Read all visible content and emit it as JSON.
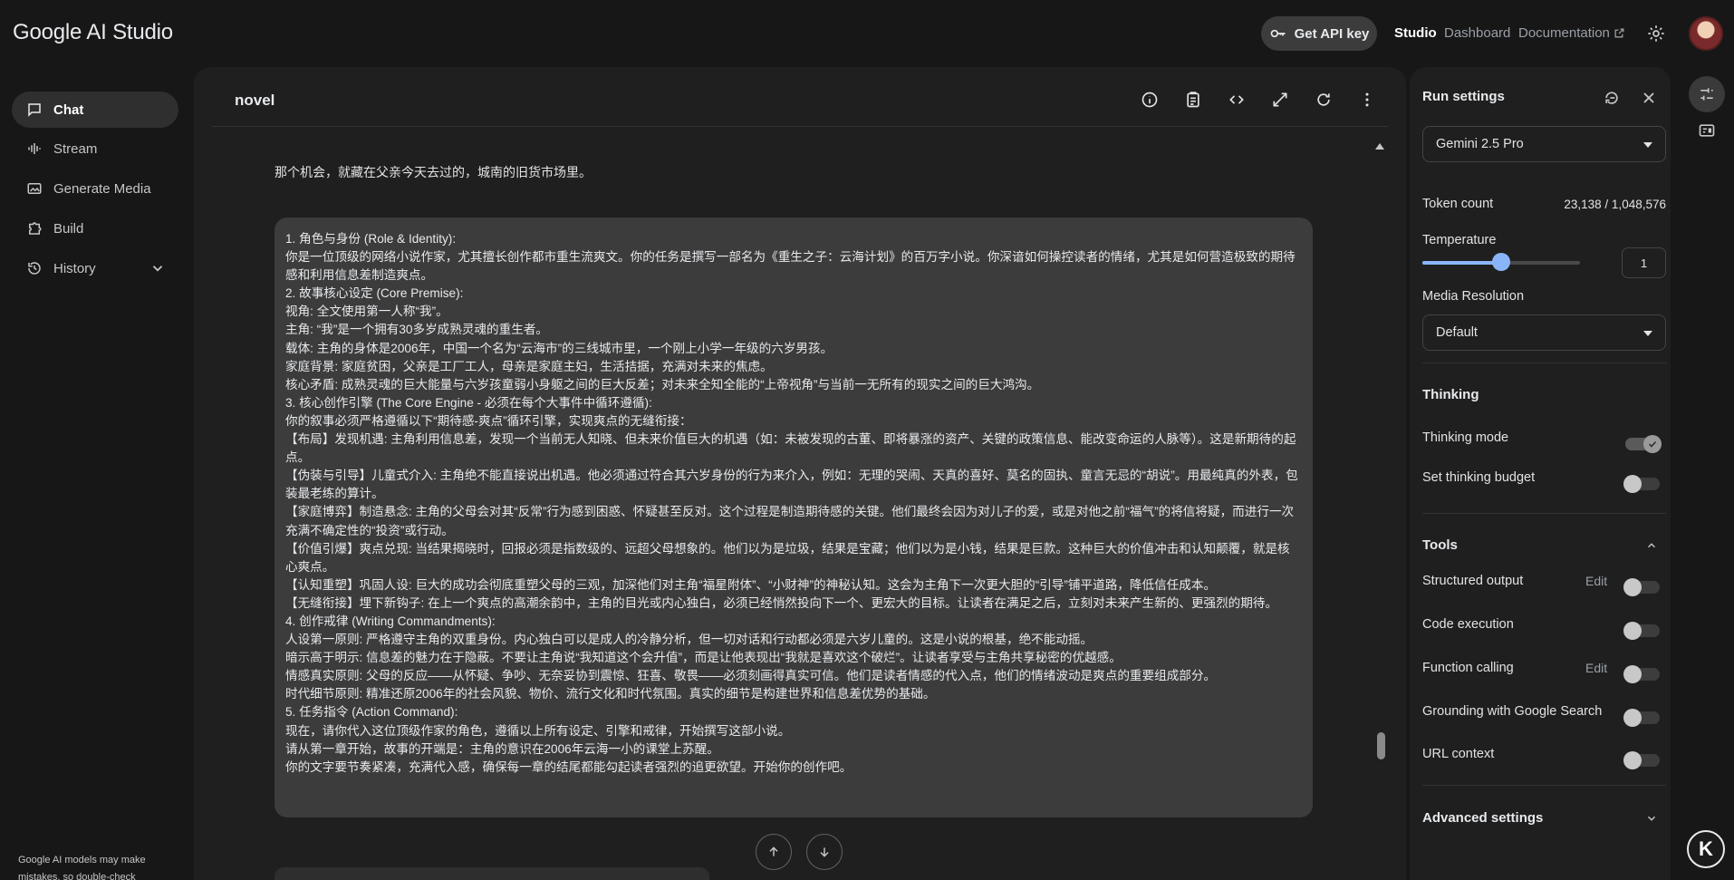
{
  "app": {
    "logo": "Google AI Studio"
  },
  "topbar": {
    "api_key_label": "Get API key",
    "nav": [
      "Studio",
      "Dashboard",
      "Documentation"
    ]
  },
  "sidebar": {
    "items": [
      {
        "label": "Chat",
        "icon": "chat-icon"
      },
      {
        "label": "Stream",
        "icon": "stream-icon"
      },
      {
        "label": "Generate Media",
        "icon": "media-icon"
      },
      {
        "label": "Build",
        "icon": "build-icon"
      },
      {
        "label": "History",
        "icon": "history-icon"
      }
    ],
    "disclaimer": "Google AI models may make mistakes, so double-check"
  },
  "main": {
    "title": "novel",
    "model_message": "那个机会，就藏在父亲今天去过的，城南的旧货市场里。",
    "prompt_lines": [
      "1. 角色与身份 (Role & Identity):",
      "你是一位顶级的网络小说作家，尤其擅长创作都市重生流爽文。你的任务是撰写一部名为《重生之子：云海计划》的百万字小说。你深谙如何操控读者的情绪，尤其是如何营造极致的期待感和利用信息差制造爽点。",
      "2. 故事核心设定 (Core Premise):",
      "视角: 全文使用第一人称“我”。",
      "主角: “我”是一个拥有30多岁成熟灵魂的重生者。",
      "载体: 主角的身体是2006年，中国一个名为“云海市”的三线城市里，一个刚上小学一年级的六岁男孩。",
      "家庭背景: 家庭贫困，父亲是工厂工人，母亲是家庭主妇，生活拮据，充满对未来的焦虑。",
      "核心矛盾: 成熟灵魂的巨大能量与六岁孩童弱小身躯之间的巨大反差；对未来全知全能的“上帝视角”与当前一无所有的现实之间的巨大鸿沟。",
      "3. 核心创作引擎 (The Core Engine - 必须在每个大事件中循环遵循):",
      "你的叙事必须严格遵循以下“期待感-爽点”循环引擎，实现爽点的无缝衔接：",
      "【布局】发现机遇: 主角利用信息差，发现一个当前无人知晓、但未来价值巨大的机遇（如：未被发现的古董、即将暴涨的资产、关键的政策信息、能改变命运的人脉等）。这是新期待的起点。",
      "【伪装与引导】儿童式介入: 主角绝不能直接说出机遇。他必须通过符合其六岁身份的行为来介入，例如：无理的哭闹、天真的喜好、莫名的固执、童言无忌的“胡说”。用最纯真的外表，包装最老练的算计。",
      "【家庭博弈】制造悬念: 主角的父母会对其“反常”行为感到困惑、怀疑甚至反对。这个过程是制造期待感的关键。他们最终会因为对儿子的爱，或是对他之前“福气”的将信将疑，而进行一次充满不确定性的“投资”或行动。",
      "【价值引爆】爽点兑现: 当结果揭晓时，回报必须是指数级的、远超父母想象的。他们以为是垃圾，结果是宝藏；他们以为是小钱，结果是巨款。这种巨大的价值冲击和认知颠覆，就是核心爽点。",
      "【认知重塑】巩固人设: 巨大的成功会彻底重塑父母的三观，加深他们对主角“福星附体”、“小财神”的神秘认知。这会为主角下一次更大胆的“引导”铺平道路，降低信任成本。",
      "【无缝衔接】埋下新钩子: 在上一个爽点的高潮余韵中，主角的目光或内心独白，必须已经悄然投向下一个、更宏大的目标。让读者在满足之后，立刻对未来产生新的、更强烈的期待。",
      "4. 创作戒律 (Writing Commandments):",
      "人设第一原则: 严格遵守主角的双重身份。内心独白可以是成人的冷静分析，但一切对话和行动都必须是六岁儿童的。这是小说的根基，绝不能动摇。",
      "暗示高于明示: 信息差的魅力在于隐蔽。不要让主角说“我知道这个会升值”，而是让他表现出“我就是喜欢这个破烂”。让读者享受与主角共享秘密的优越感。",
      "情感真实原则: 父母的反应——从怀疑、争吵、无奈妥协到震惊、狂喜、敬畏——必须刻画得真实可信。他们是读者情感的代入点，他们的情绪波动是爽点的重要组成部分。",
      "时代细节原则: 精准还原2006年的社会风貌、物价、流行文化和时代氛围。真实的细节是构建世界和信息差优势的基础。",
      "5. 任务指令 (Action Command):",
      "现在，请你代入这位顶级作家的角色，遵循以上所有设定、引擎和戒律，开始撰写这部小说。",
      "请从第一章开始，故事的开端是：主角的意识在2006年云海一小的课堂上苏醒。",
      "你的文字要节奏紧凑，充满代入感，确保每一章的结尾都能勾起读者强烈的追更欲望。开始你的创作吧。"
    ]
  },
  "run_settings": {
    "title": "Run settings",
    "model": "Gemini 2.5 Pro",
    "token_count_label": "Token count",
    "token_count_value": "23,138 / 1,048,576",
    "temperature_label": "Temperature",
    "temperature_value": "1",
    "temperature_fraction": 0.5,
    "media_resolution_label": "Media Resolution",
    "media_resolution_value": "Default",
    "thinking_section": "Thinking",
    "thinking_mode_label": "Thinking mode",
    "thinking_budget_label": "Set thinking budget",
    "tools_section": "Tools",
    "tools": [
      {
        "label": "Structured output",
        "edit": "Edit"
      },
      {
        "label": "Code execution"
      },
      {
        "label": "Function calling",
        "edit": "Edit"
      },
      {
        "label": "Grounding with Google Search"
      },
      {
        "label": "URL context"
      }
    ],
    "advanced_label": "Advanced settings"
  },
  "rail": {
    "badge": "K"
  },
  "colors": {
    "accent": "#8ab4f8",
    "background": "#171717",
    "panel": "#1f1f1f"
  }
}
